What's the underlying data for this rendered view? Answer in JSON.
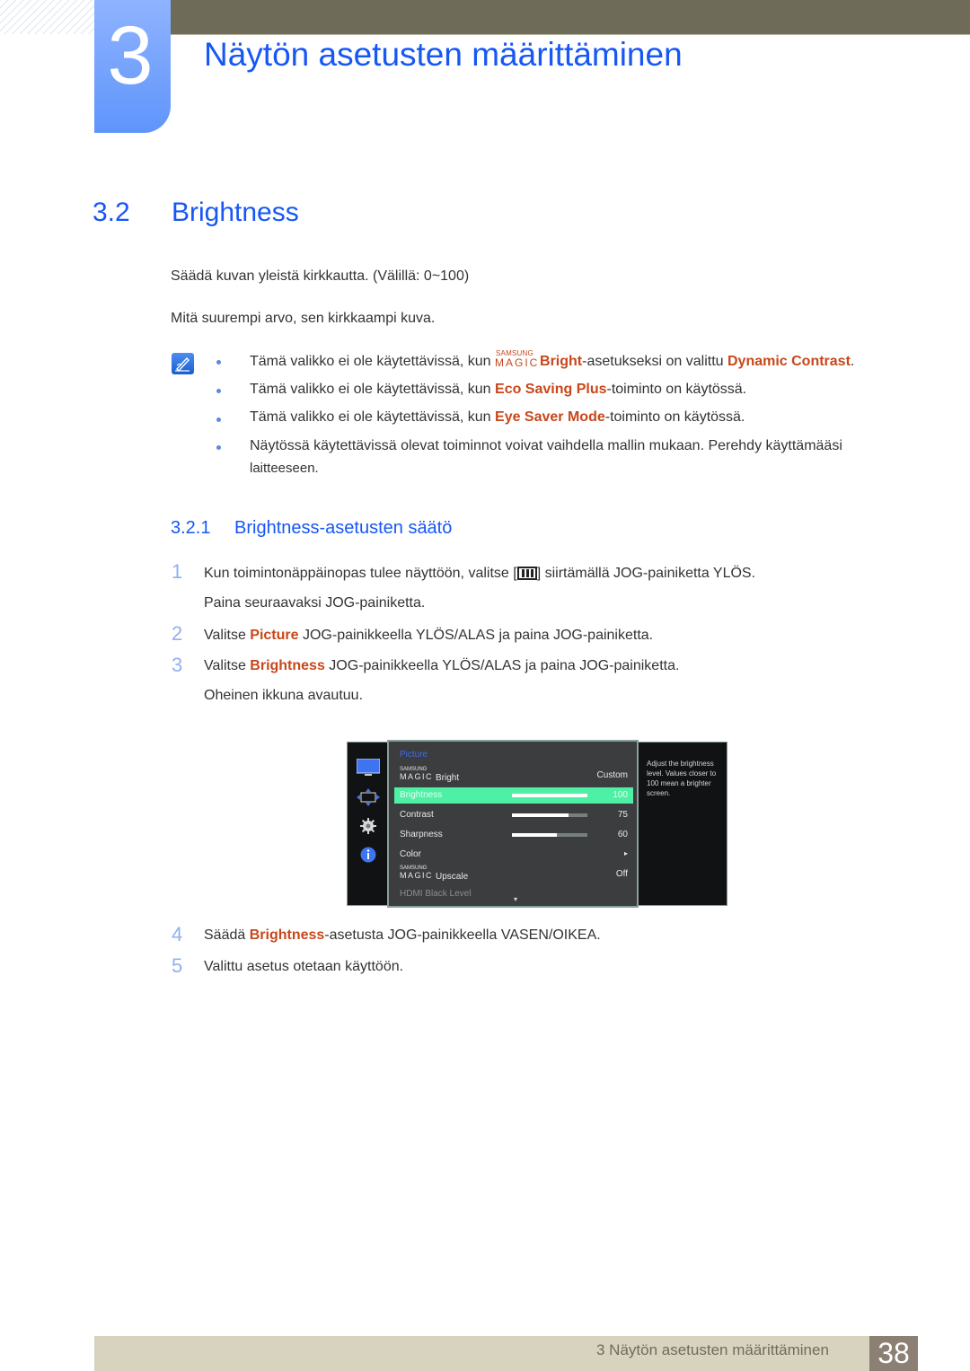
{
  "chapter": {
    "number": "3",
    "title": "Näytön asetusten määrittäminen"
  },
  "section": {
    "number": "3.2",
    "title": "Brightness"
  },
  "intro": [
    "Säädä kuvan yleistä kirkkautta. (Välillä: 0~100)",
    "Mitä suurempi arvo, sen kirkkaampi kuva."
  ],
  "notes": {
    "icon": "note-pencil-icon",
    "items": [
      {
        "pre": "Tämä valikko ei ole käytettävissä, kun ",
        "magic_top": "SAMSUNG",
        "magic_bottom": "MAGIC",
        "hl1": "Bright",
        "mid": "-asetukseksi on valittu ",
        "hl2": "Dynamic Contrast",
        "post": "."
      },
      {
        "pre": "Tämä valikko ei ole käytettävissä, kun ",
        "hl1": "Eco Saving Plus",
        "post": "-toiminto on käytössä."
      },
      {
        "pre": "Tämä valikko ei ole käytettävissä, kun ",
        "hl1": "Eye Saver Mode",
        "post": "-toiminto on käytössä."
      },
      {
        "line1": "Näytössä käytettävissä olevat toiminnot voivat vaihdella mallin mukaan. Perehdy käyttämääsi",
        "line2": "laitteeseen."
      }
    ]
  },
  "subsection": {
    "number": "3.2.1",
    "title": "Brightness-asetusten säätö"
  },
  "steps": [
    {
      "n": "1",
      "pre": "Kun toimintonäppäinopas tulee näyttöön, valitse [",
      "icon": "menu-icon",
      "post": "] siirtämällä JOG-painiketta YLÖS.",
      "line2": "Paina seuraavaksi JOG-painiketta."
    },
    {
      "n": "2",
      "pre": "Valitse ",
      "hl": "Picture",
      "post": " JOG-painikkeella YLÖS/ALAS ja paina JOG-painiketta."
    },
    {
      "n": "3",
      "pre": "Valitse ",
      "hl": "Brightness",
      "post": " JOG-painikkeella YLÖS/ALAS ja paina JOG-painiketta.",
      "line2": "Oheinen ikkuna avautuu."
    },
    {
      "n": "4",
      "pre": "Säädä ",
      "hl": "Brightness",
      "post": "-asetusta JOG-painikkeella VASEN/OIKEA."
    },
    {
      "n": "5",
      "pre": "Valittu asetus otetaan käyttöön."
    }
  ],
  "osd": {
    "side_icons": [
      "monitor-icon",
      "resize-arrows-icon",
      "gear-icon",
      "info-icon"
    ],
    "title": "Picture",
    "rows": [
      {
        "magic_top": "SAMSUNG",
        "magic_bottom": "MAGIC",
        "label": "Bright",
        "value": "Custom"
      },
      {
        "label": "Brightness",
        "value": "100",
        "level": 100,
        "selected": true
      },
      {
        "label": "Contrast",
        "value": "75",
        "level": 75
      },
      {
        "label": "Sharpness",
        "value": "60",
        "level": 60
      },
      {
        "label": "Color",
        "value": "▸"
      },
      {
        "magic_top": "SAMSUNG",
        "magic_bottom": "MAGIC",
        "label": "Upscale",
        "value": "Off"
      },
      {
        "label": "HDMI Black Level",
        "disabled": true
      }
    ],
    "scroll_indicator": "▾",
    "help_text": "Adjust the brightness level. Values closer to 100 mean a brighter screen."
  },
  "footer": {
    "text": "3 Näytön asetusten määrittäminen",
    "page": "38"
  },
  "colors": {
    "heading_blue": "#1657f5",
    "highlight": "#c8471a",
    "osd_selected": "#4df0a4",
    "footer_bg": "#d8d3bf",
    "page_box": "#8c7f74"
  }
}
